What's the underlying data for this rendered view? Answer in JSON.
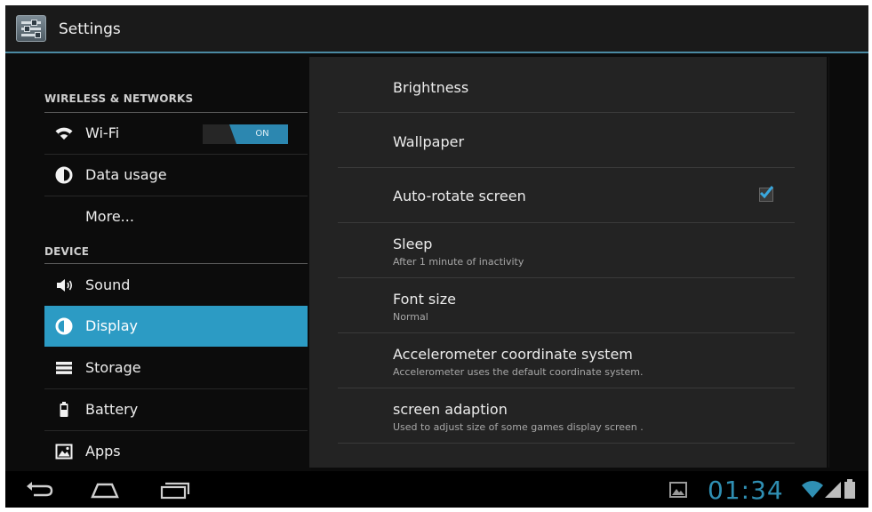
{
  "app": {
    "title": "Settings"
  },
  "sidebar": {
    "sections": [
      {
        "header": "WIRELESS & NETWORKS"
      },
      {
        "header": "DEVICE"
      }
    ],
    "items": [
      {
        "label": "Wi-Fi",
        "icon": "wifi-icon",
        "toggle": "ON"
      },
      {
        "label": "Data usage",
        "icon": "data-usage-icon"
      },
      {
        "label": "More..."
      },
      {
        "label": "Sound",
        "icon": "speaker-icon"
      },
      {
        "label": "Display",
        "icon": "display-icon",
        "selected": true
      },
      {
        "label": "Storage",
        "icon": "storage-icon"
      },
      {
        "label": "Battery",
        "icon": "battery-icon"
      },
      {
        "label": "Apps",
        "icon": "apps-icon"
      }
    ]
  },
  "display_settings": [
    {
      "title": "Brightness"
    },
    {
      "title": "Wallpaper"
    },
    {
      "title": "Auto-rotate screen",
      "checked": true
    },
    {
      "title": "Sleep",
      "summary": "After 1 minute of inactivity"
    },
    {
      "title": "Font size",
      "summary": "Normal"
    },
    {
      "title": "Accelerometer coordinate system",
      "summary": "Accelerometer uses the default coordinate system."
    },
    {
      "title": "screen adaption",
      "summary": "Used to adjust size of some games display screen ."
    }
  ],
  "status_bar": {
    "time": "01:34"
  },
  "colors": {
    "accent": "#2c9bc4",
    "clock": "#2f8fb3"
  }
}
